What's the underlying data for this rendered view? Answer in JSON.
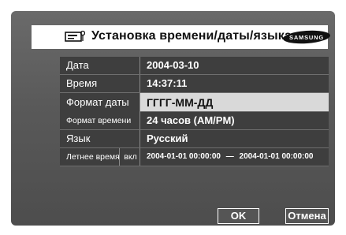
{
  "dialog": {
    "title": "Установка времени/даты/языка",
    "brand": "SAMSUNG"
  },
  "settings": {
    "date": {
      "label": "Дата",
      "value": "2004-03-10"
    },
    "time": {
      "label": "Время",
      "value": "14:37:11"
    },
    "date_format": {
      "label": "Формат даты",
      "value": "ГГГГ-ММ-ДД"
    },
    "time_format": {
      "label": "Формат времени",
      "value": "24 часов (AM/PM)"
    },
    "language": {
      "label": "Язык",
      "value": "Русский"
    },
    "dst": {
      "label": "Летнее время",
      "toggle": "вкл",
      "range_start": "2004-01-01 00:00:00",
      "separator": "—",
      "range_end": "2004-01-01 00:00:00"
    }
  },
  "buttons": {
    "ok": "OK",
    "cancel": "Отмена"
  },
  "colors": {
    "panel": "#595959",
    "row": "#3e3e3e",
    "selected_row": "#d9d9d9"
  }
}
